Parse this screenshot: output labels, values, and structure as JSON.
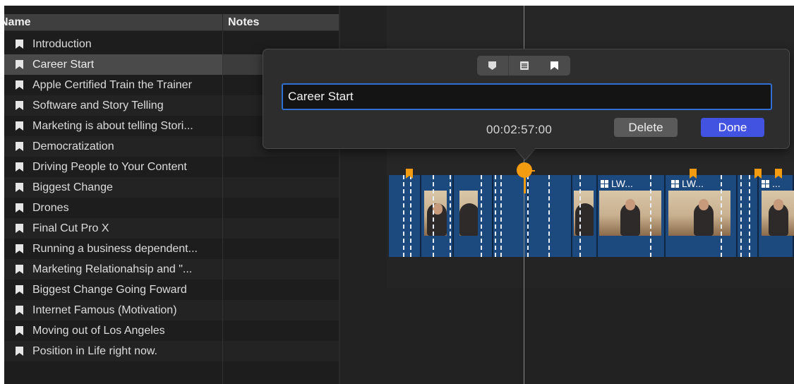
{
  "index": {
    "columns": {
      "name": "Name",
      "notes": "Notes"
    },
    "markers": [
      {
        "label": "Introduction",
        "selected": false
      },
      {
        "label": "Career Start",
        "selected": true
      },
      {
        "label": "Apple Certified Train the Trainer",
        "selected": false
      },
      {
        "label": "Software and Story Telling",
        "selected": false
      },
      {
        "label": "Marketing is about telling Stori...",
        "selected": false
      },
      {
        "label": "Democratization",
        "selected": false
      },
      {
        "label": "Driving People to Your Content",
        "selected": false
      },
      {
        "label": "Biggest Change",
        "selected": false
      },
      {
        "label": "Drones",
        "selected": false
      },
      {
        "label": "Final Cut Pro X",
        "selected": false
      },
      {
        "label": "Running a business dependent...",
        "selected": false
      },
      {
        "label": "Marketing Relationahsip and \"...",
        "selected": false
      },
      {
        "label": "Biggest Change Going Foward",
        "selected": false
      },
      {
        "label": "Internet Famous (Motivation)",
        "selected": false
      },
      {
        "label": "Moving out of Los Angeles",
        "selected": false
      },
      {
        "label": "Position in Life right now.",
        "selected": false
      }
    ]
  },
  "popover": {
    "marker_types": [
      {
        "id": "standard",
        "icon": "standard-marker-icon",
        "active": false
      },
      {
        "id": "todo",
        "icon": "todo-marker-icon",
        "active": false
      },
      {
        "id": "chapter",
        "icon": "chapter-marker-icon",
        "active": true
      }
    ],
    "marker_name": "Career Start",
    "timecode": "00:02:57:00",
    "delete_label": "Delete",
    "done_label": "Done"
  },
  "timeline": {
    "clip_titles": [
      "LW...",
      "LW...",
      "..."
    ]
  },
  "colors": {
    "accent_blue": "#4253e2",
    "marker_orange": "#f39c12",
    "clip_blue": "#1d4a7e",
    "audio_blue": "#5b87bd"
  }
}
